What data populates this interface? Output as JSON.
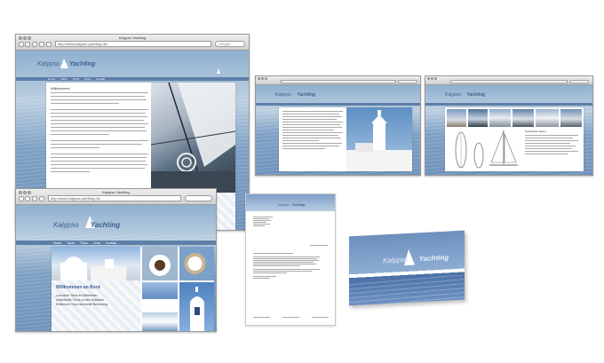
{
  "browser_main": {
    "window_title": "Kalypso Yachting",
    "url": "http://www.kalypso-yachting.de/",
    "search_placeholder": "Google",
    "logo_part1": "Kalypso",
    "logo_part2": "Yachting",
    "heading": "Willkommen",
    "nav": [
      "Home",
      "Yacht",
      "Törns",
      "Crew",
      "Kontakt"
    ]
  },
  "browser_small2": {
    "logo_part1": "Kalypso",
    "logo_part2": "Yachting"
  },
  "browser_small3": {
    "logo_part1": "Kalypso",
    "logo_part2": "Yachting",
    "table_heading": "Technische Daten"
  },
  "browser_bottom": {
    "window_title": "Kalypso Yachting",
    "url": "http://www.kalypso-yachting.de/",
    "logo_part1": "Kalypso",
    "logo_part2": "Yachting",
    "nav": [
      "Home",
      "Yacht",
      "Törns",
      "Crew",
      "Kontakt"
    ],
    "box_heading": "Willkommen an Bord",
    "box_lines": [
      "Luxuriöse Yacht im Mittelmeer",
      "Individuelle Törns zu den Kykladen",
      "Erfahrene Crew und beste Betreuung"
    ]
  },
  "letterhead": {
    "logo_part1": "Kalypso",
    "logo_part2": "Yachting"
  },
  "business_card": {
    "logo_part1": "Kalypso",
    "logo_part2": "Yachting"
  },
  "colors": {
    "brand_blue": "#3d5f8e",
    "nav_blue": "#5d7fa8",
    "sea_blue": "#6f93bb"
  }
}
